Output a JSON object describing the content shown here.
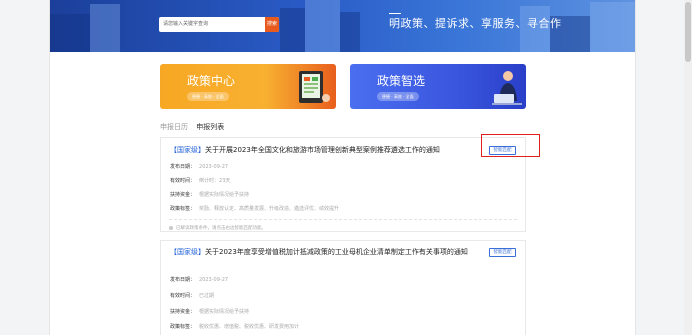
{
  "header": {
    "search_placeholder": "请您输入关键字查询",
    "search_button": "搜索",
    "slogan": "明政策、提诉求、享服务、寻合作"
  },
  "entries": [
    {
      "title": "政策中心",
      "tagline": "便捷 · 高效 · 全面",
      "color": "#f7a823"
    },
    {
      "title": "政策智选",
      "tagline": "便捷 · 高效 · 全面",
      "color": "#3a56de"
    }
  ],
  "tabs": [
    {
      "label": "申报日历",
      "active": false
    },
    {
      "label": "申报列表",
      "active": true
    }
  ],
  "policies": [
    {
      "level": "【国家级】",
      "title": "关于开展2023年全国文化和旅游市场管理创新典型案例推荐遴选工作的通知",
      "match_button": "智能匹配",
      "fields": [
        {
          "label": "发布日期：",
          "value": "2023-09-27"
        },
        {
          "label": "有效时间：",
          "value": "倒计时：23天"
        },
        {
          "label": "扶持资金：",
          "value": "根据实际情况给予扶持"
        },
        {
          "label": "政策标签：",
          "value": "奖励、释放认定、高质量发展、升级改造、遴选评优、绩效提升"
        }
      ],
      "footer": "已解读政策条件，请点击右边智能匹配功能。"
    },
    {
      "level": "【国家级】",
      "title": "关于2023年度享受增值税加计抵减政策的工业母机企业清单制定工作有关事项的通知",
      "match_button": "智能匹配",
      "fields": [
        {
          "label": "发布日期：",
          "value": "2023-09-27"
        },
        {
          "label": "有效时间：",
          "value": "已过期"
        },
        {
          "label": "扶持资金：",
          "value": "根据实际情况给予扶持"
        },
        {
          "label": "政策标签：",
          "value": "税收优惠、增值税、税收优惠、研发费用加计"
        }
      ]
    }
  ]
}
